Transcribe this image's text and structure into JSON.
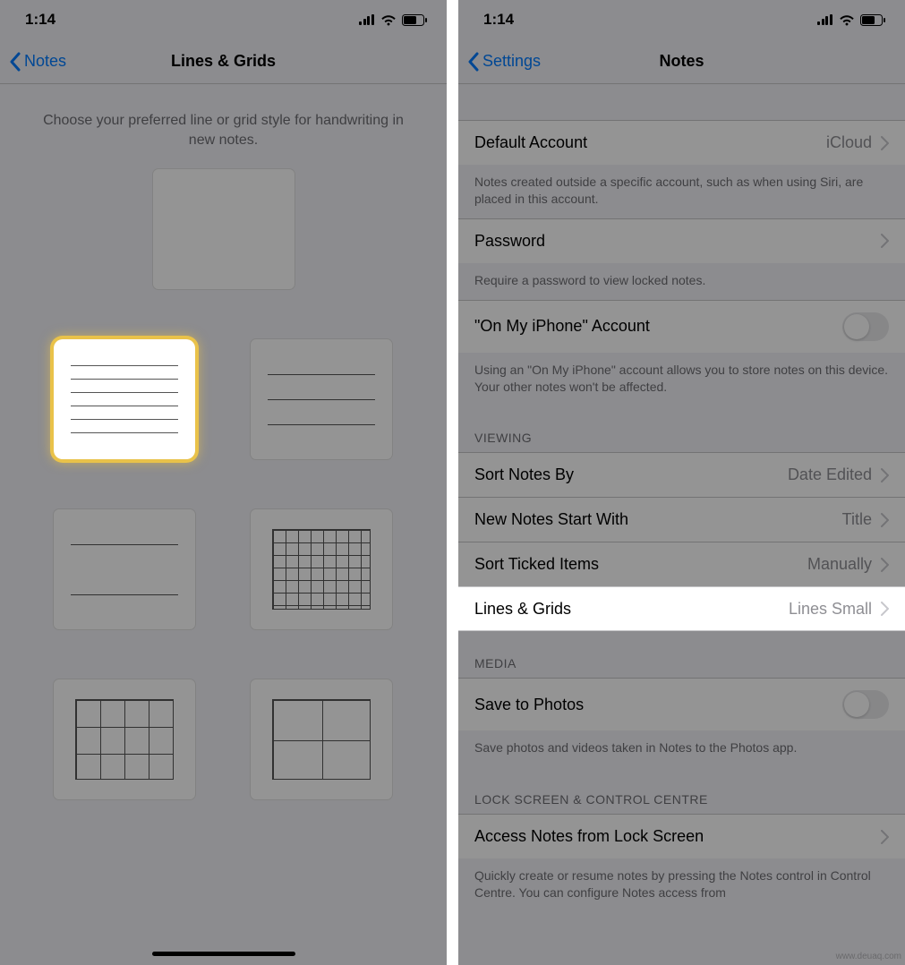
{
  "status": {
    "time": "1:14"
  },
  "left": {
    "back_label": "Notes",
    "title": "Lines & Grids",
    "description": "Choose your preferred line or grid style for handwriting in new notes.",
    "options": [
      "Blank",
      "Lines Small",
      "Lines Medium",
      "Lines Large",
      "Grid Small",
      "Grid Medium",
      "Grid Large"
    ]
  },
  "right": {
    "back_label": "Settings",
    "title": "Notes",
    "rows": {
      "default_account": {
        "label": "Default Account",
        "value": "iCloud"
      },
      "default_account_footer": "Notes created outside a specific account, such as when using Siri, are placed in this account.",
      "password": {
        "label": "Password"
      },
      "password_footer": "Require a password to view locked notes.",
      "on_my_iphone": {
        "label": "\"On My iPhone\" Account"
      },
      "on_my_iphone_footer": "Using an \"On My iPhone\" account allows you to store notes on this device. Your other notes won't be affected.",
      "viewing_header": "VIEWING",
      "sort_by": {
        "label": "Sort Notes By",
        "value": "Date Edited"
      },
      "start_with": {
        "label": "New Notes Start With",
        "value": "Title"
      },
      "sort_ticked": {
        "label": "Sort Ticked Items",
        "value": "Manually"
      },
      "lines_grids": {
        "label": "Lines & Grids",
        "value": "Lines Small"
      },
      "media_header": "MEDIA",
      "save_photos": {
        "label": "Save to Photos"
      },
      "save_photos_footer": "Save photos and videos taken in Notes to the Photos app.",
      "lock_header": "LOCK SCREEN & CONTROL CENTRE",
      "access_lock": {
        "label": "Access Notes from Lock Screen"
      },
      "access_lock_footer": "Quickly create or resume notes by pressing the Notes control in Control Centre. You can configure Notes access from"
    }
  },
  "watermark": "www.deuaq.com"
}
